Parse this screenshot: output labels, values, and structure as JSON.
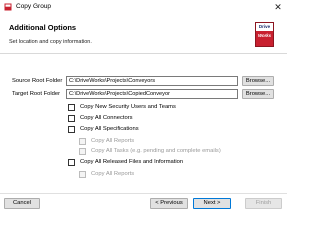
{
  "window": {
    "title": "Copy Group",
    "close_glyph": "✕",
    "app_icon": "copy-group-app-icon"
  },
  "header": {
    "title": "Additional Options",
    "subtitle": "Set location and copy information.",
    "logo": {
      "line1": "Drive",
      "line2": "Works",
      "brand_color": "#c8202f"
    }
  },
  "fields": {
    "source_label": "Source Root Folder",
    "source_value": "C:\\DriveWorks\\Projects\\Conveyors",
    "target_label": "Target Root Folder",
    "target_value": "C:\\DriveWorks\\Projects\\CopiedConveyor",
    "browse_label": "Browse..."
  },
  "options": [
    {
      "label": "Copy New Security Users and Teams",
      "checked": false,
      "enabled": true
    },
    {
      "label": "Copy All Connectors",
      "checked": false,
      "enabled": true
    },
    {
      "label": "Copy All Specifications",
      "checked": false,
      "enabled": true
    },
    {
      "label": "Copy All Reports",
      "checked": false,
      "enabled": false
    },
    {
      "label": "Copy All Tasks (e.g. pending and complete emails)",
      "checked": false,
      "enabled": false
    },
    {
      "label": "Copy All Released Files and Information",
      "checked": false,
      "enabled": true
    },
    {
      "label": "Copy All Reports",
      "checked": false,
      "enabled": false
    }
  ],
  "footer": {
    "cancel_label": "Cancel",
    "previous_label": "< Previous",
    "next_label": "Next >",
    "finish_label": "Finish"
  },
  "colors": {
    "primary_border": "#0078d7",
    "disabled_text": "#9a9a9a"
  }
}
